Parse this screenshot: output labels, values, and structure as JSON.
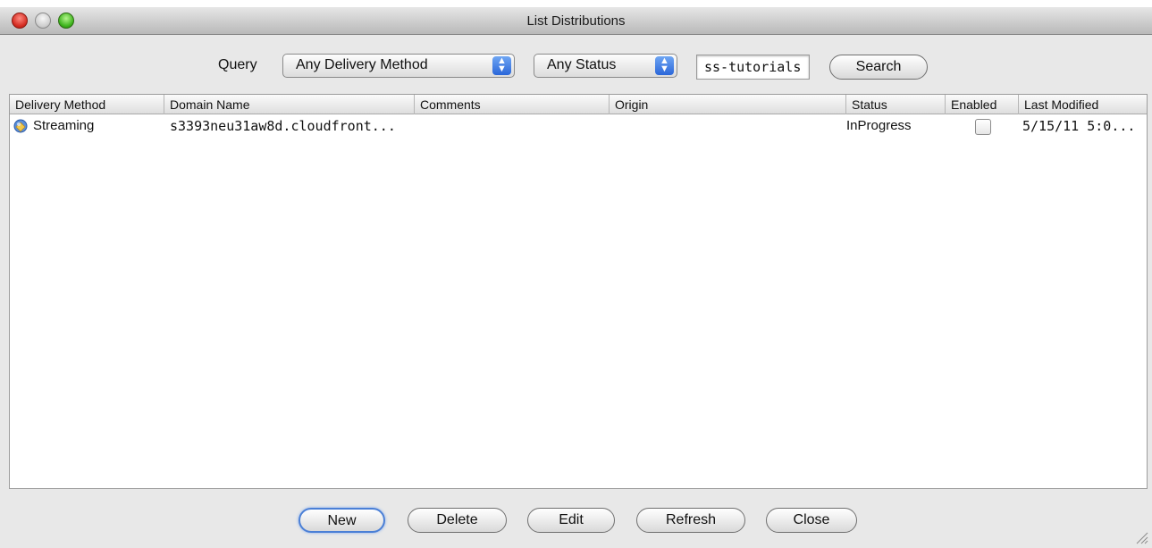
{
  "window": {
    "title": "List Distributions"
  },
  "query": {
    "label": "Query",
    "delivery_method": {
      "selected": "Any Delivery Method"
    },
    "status": {
      "selected": "Any Status"
    },
    "search_value": "ss-tutorials",
    "search_button": "Search"
  },
  "table": {
    "columns": [
      "Delivery Method",
      "Domain Name",
      "Comments",
      "Origin",
      "Status",
      "Enabled",
      "Last Modified"
    ],
    "rows": [
      {
        "delivery_method": "Streaming",
        "domain_name": "s3393neu31aw8d.cloudfront...",
        "comments": "",
        "origin": "",
        "status": "InProgress",
        "enabled": false,
        "last_modified": "5/15/11 5:0..."
      }
    ]
  },
  "buttons": {
    "new": "New",
    "delete": "Delete",
    "edit": "Edit",
    "refresh": "Refresh",
    "close": "Close"
  },
  "icons": {
    "row_icon": "streaming-distribution-icon",
    "stepper": "up-down-arrows-icon",
    "grip": "resize-grip-icon"
  },
  "colors": {
    "default_button_border": "#4a7fd6",
    "stepper_blue": "#2a66d9"
  }
}
